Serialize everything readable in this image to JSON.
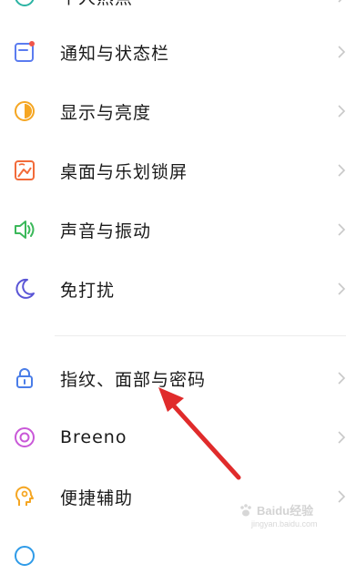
{
  "menu": {
    "items": [
      {
        "label": "个人热点",
        "icon": "hotspot-icon",
        "color": "#2bb3a3"
      },
      {
        "label": "通知与状态栏",
        "icon": "notification-icon",
        "color": "#5b7cf0"
      },
      {
        "label": "显示与亮度",
        "icon": "display-brightness-icon",
        "color": "#f5a623"
      },
      {
        "label": "桌面与乐划锁屏",
        "icon": "wallpaper-icon",
        "color": "#f26b3a"
      },
      {
        "label": "声音与振动",
        "icon": "sound-icon",
        "color": "#3bb85a"
      },
      {
        "label": "免打扰",
        "icon": "moon-icon",
        "color": "#5a55d6"
      },
      {
        "label": "指纹、面部与密码",
        "icon": "lock-icon",
        "color": "#4a7de8"
      },
      {
        "label": "Breeno",
        "icon": "breeno-icon",
        "color": "#c958d8"
      },
      {
        "label": "便捷辅助",
        "icon": "assist-icon",
        "color": "#f5a623"
      },
      {
        "label": "",
        "icon": "partial-icon",
        "color": "#2f9be8"
      }
    ]
  },
  "watermark": {
    "brand": "Baidu经验",
    "url": "jingyan.baidu.com"
  },
  "colors": {
    "arrow": "#e02b2b",
    "chevron": "#c8c8c8",
    "divider": "#ececec"
  }
}
